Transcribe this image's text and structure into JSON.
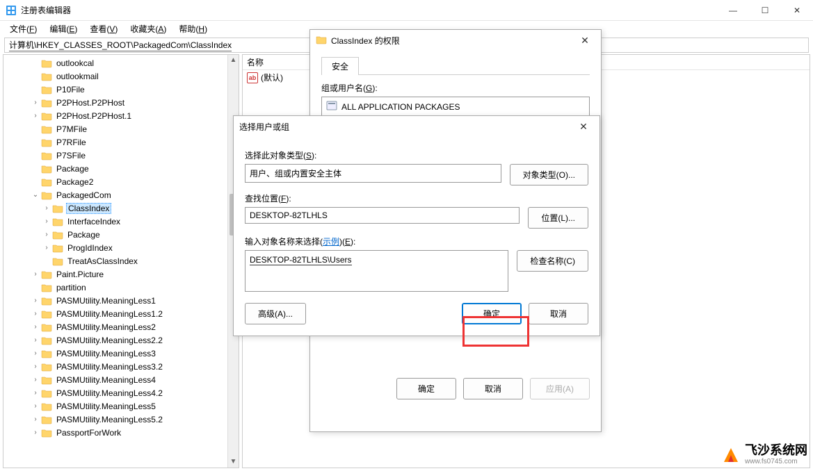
{
  "window": {
    "title": "注册表编辑器",
    "min": "—",
    "max": "☐",
    "close": "✕"
  },
  "menu": {
    "file": "文件(",
    "file_ul": "F",
    "file_end": ")",
    "edit": "编辑(",
    "edit_ul": "E",
    "edit_end": ")",
    "view": "查看(",
    "view_ul": "V",
    "view_end": ")",
    "fav": "收藏夹(",
    "fav_ul": "A",
    "fav_end": ")",
    "help": "帮助(",
    "help_ul": "H",
    "help_end": ")"
  },
  "address": "计算机\\HKEY_CLASSES_ROOT\\PackagedCom\\ClassIndex",
  "tree": [
    {
      "d": 2,
      "e": "",
      "l": "outlookcal"
    },
    {
      "d": 2,
      "e": "",
      "l": "outlookmail"
    },
    {
      "d": 2,
      "e": "",
      "l": "P10File"
    },
    {
      "d": 2,
      "e": ">",
      "l": "P2PHost.P2PHost"
    },
    {
      "d": 2,
      "e": ">",
      "l": "P2PHost.P2PHost.1"
    },
    {
      "d": 2,
      "e": "",
      "l": "P7MFile"
    },
    {
      "d": 2,
      "e": "",
      "l": "P7RFile"
    },
    {
      "d": 2,
      "e": "",
      "l": "P7SFile"
    },
    {
      "d": 2,
      "e": "",
      "l": "Package"
    },
    {
      "d": 2,
      "e": "",
      "l": "Package2"
    },
    {
      "d": 2,
      "e": "v",
      "l": "PackagedCom"
    },
    {
      "d": 3,
      "e": ">",
      "l": "ClassIndex",
      "sel": true
    },
    {
      "d": 3,
      "e": ">",
      "l": "InterfaceIndex"
    },
    {
      "d": 3,
      "e": ">",
      "l": "Package"
    },
    {
      "d": 3,
      "e": ">",
      "l": "ProgIdIndex"
    },
    {
      "d": 3,
      "e": "",
      "l": "TreatAsClassIndex"
    },
    {
      "d": 2,
      "e": ">",
      "l": "Paint.Picture"
    },
    {
      "d": 2,
      "e": "",
      "l": "partition"
    },
    {
      "d": 2,
      "e": ">",
      "l": "PASMUtility.MeaningLess1"
    },
    {
      "d": 2,
      "e": ">",
      "l": "PASMUtility.MeaningLess1.2"
    },
    {
      "d": 2,
      "e": ">",
      "l": "PASMUtility.MeaningLess2"
    },
    {
      "d": 2,
      "e": ">",
      "l": "PASMUtility.MeaningLess2.2"
    },
    {
      "d": 2,
      "e": ">",
      "l": "PASMUtility.MeaningLess3"
    },
    {
      "d": 2,
      "e": ">",
      "l": "PASMUtility.MeaningLess3.2"
    },
    {
      "d": 2,
      "e": ">",
      "l": "PASMUtility.MeaningLess4"
    },
    {
      "d": 2,
      "e": ">",
      "l": "PASMUtility.MeaningLess4.2"
    },
    {
      "d": 2,
      "e": ">",
      "l": "PASMUtility.MeaningLess5"
    },
    {
      "d": 2,
      "e": ">",
      "l": "PASMUtility.MeaningLess5.2"
    },
    {
      "d": 2,
      "e": ">",
      "l": "PassportForWork"
    }
  ],
  "values": {
    "header_name": "名称",
    "default_icon": "ab",
    "default_label": "(默认)"
  },
  "perm_dialog": {
    "title": "ClassIndex 的权限",
    "tab": "安全",
    "group_label_pre": "组或用户名(",
    "group_label_ul": "G",
    "group_label_post": "):",
    "group_item": "ALL APPLICATION PACKAGES",
    "ok": "确定",
    "cancel": "取消",
    "apply_pre": "应用(",
    "apply_ul": "A",
    "apply_post": ")"
  },
  "select_dialog": {
    "title": "选择用户或组",
    "obj_type_label_pre": "选择此对象类型(",
    "obj_type_label_ul": "S",
    "obj_type_label_post": "):",
    "obj_type_value": "用户、组或内置安全主体",
    "obj_type_btn_pre": "对象类型(",
    "obj_type_btn_ul": "O",
    "obj_type_btn_post": ")...",
    "location_label_pre": "查找位置(",
    "location_label_ul": "F",
    "location_label_post": "):",
    "location_value": "DESKTOP-82TLHLS",
    "location_btn_pre": "位置(",
    "location_btn_ul": "L",
    "location_btn_post": ")...",
    "names_label_pre": "输入对象名称来选择(",
    "names_example": "示例",
    "names_label_mid": ")(",
    "names_label_ul": "E",
    "names_label_post": "):",
    "names_value": "DESKTOP-82TLHLS\\Users",
    "check_btn_pre": "检查名称(",
    "check_btn_ul": "C",
    "check_btn_post": ")",
    "advanced_pre": "高级(",
    "advanced_ul": "A",
    "advanced_post": ")...",
    "ok": "确定",
    "cancel": "取消"
  },
  "watermark": {
    "big": "飞沙系统网",
    "small": "www.fs0745.com"
  }
}
